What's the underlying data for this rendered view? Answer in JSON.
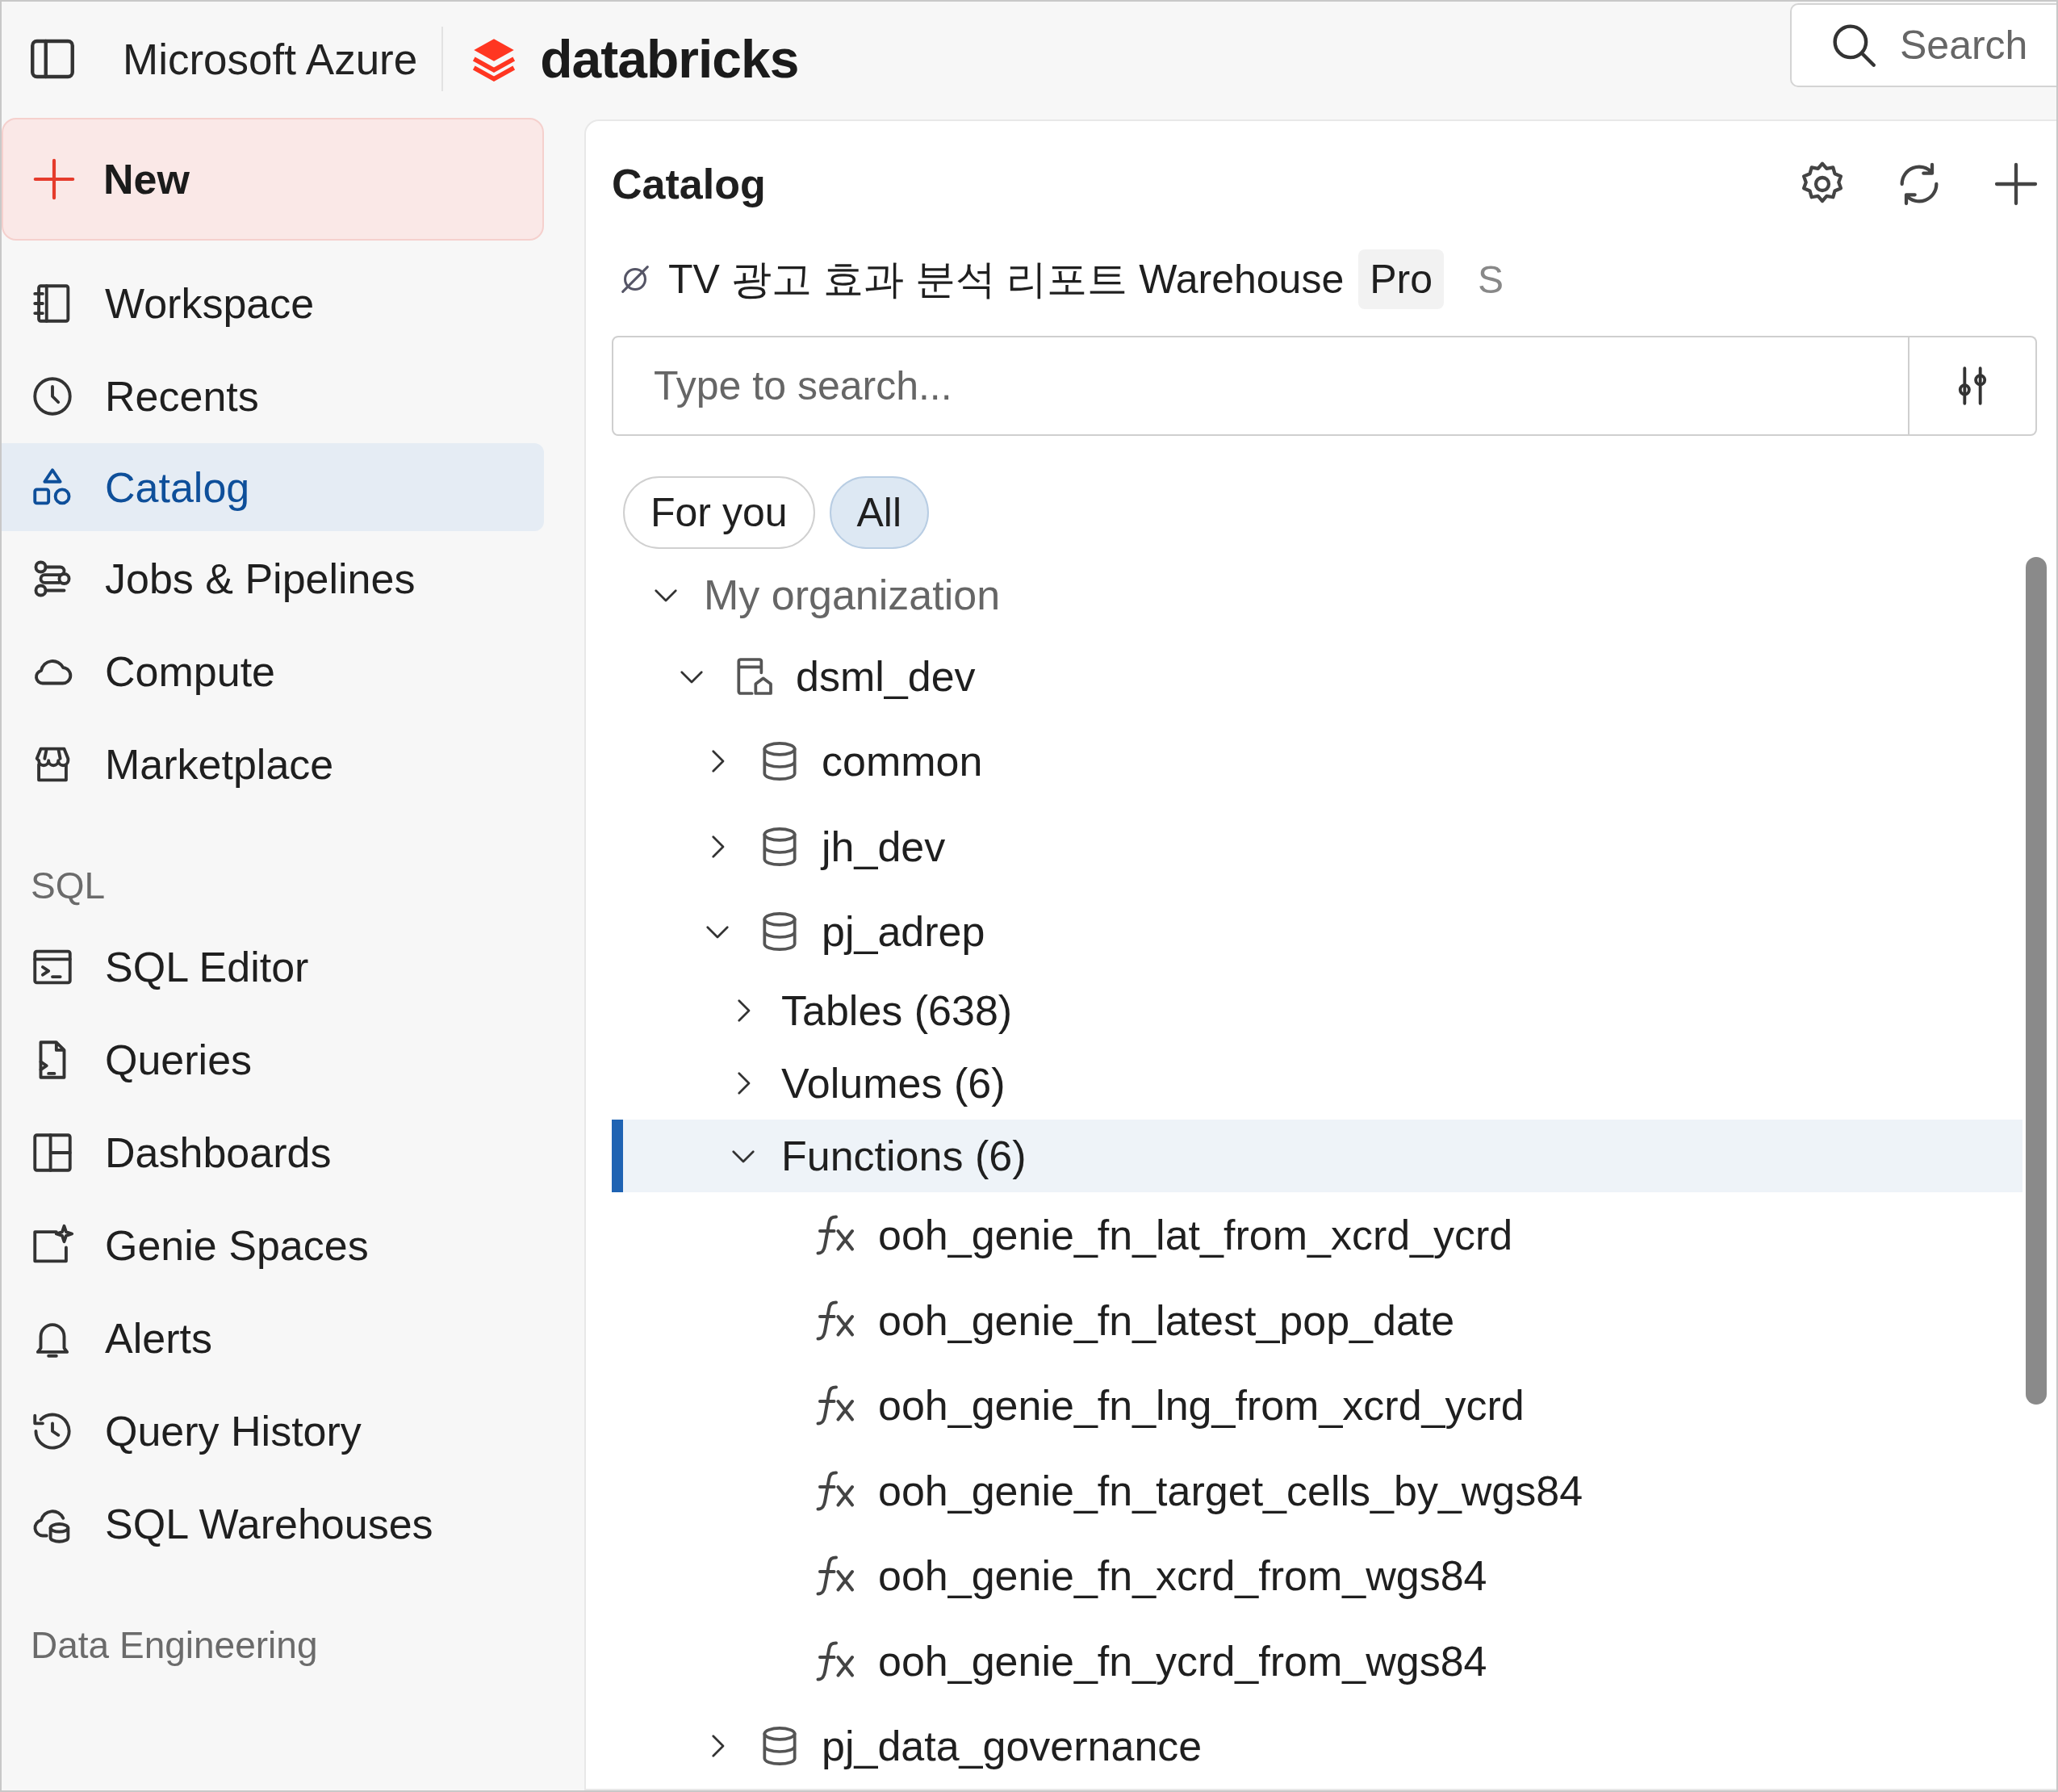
{
  "top_bar": {
    "menu_label": "Microsoft Azure",
    "brand": "databricks",
    "search": {
      "placeholder": "Search"
    }
  },
  "sidebar": {
    "new_button": "New",
    "sections": [
      {
        "items": [
          {
            "label": "Workspace",
            "selected": false
          },
          {
            "label": "Recents",
            "selected": false
          },
          {
            "label": "Catalog",
            "selected": true
          },
          {
            "label": "Jobs & Pipelines",
            "selected": false
          },
          {
            "label": "Compute",
            "selected": false
          },
          {
            "label": "Marketplace",
            "selected": false
          }
        ]
      },
      {
        "heading": "SQL",
        "items": [
          {
            "label": "SQL Editor",
            "selected": false
          },
          {
            "label": "Queries",
            "selected": false
          },
          {
            "label": "Dashboards",
            "selected": false
          },
          {
            "label": "Genie Spaces",
            "selected": false
          },
          {
            "label": "Alerts",
            "selected": false
          },
          {
            "label": "Query History",
            "selected": false
          },
          {
            "label": "SQL Warehouses",
            "selected": false
          }
        ]
      },
      {
        "heading": "Data Engineering"
      }
    ]
  },
  "catalog": {
    "title": "Catalog",
    "warehouse": {
      "name": "TV 광고 효과 분석 리포트 Warehouse",
      "badge": "Pro",
      "size": "S"
    },
    "search": {
      "placeholder": "Type to search..."
    },
    "filters": [
      {
        "label": "For you",
        "selected": false
      },
      {
        "label": "All",
        "selected": true
      }
    ],
    "tree": [
      {
        "label": "My organization",
        "kind": "group",
        "expanded": true,
        "selected": false,
        "children": [
          {
            "label": "dsml_dev",
            "kind": "catalog",
            "expanded": true,
            "selected": false,
            "children": [
              {
                "label": "common",
                "kind": "schema",
                "expanded": false,
                "selected": false
              },
              {
                "label": "jh_dev",
                "kind": "schema",
                "expanded": false,
                "selected": false
              },
              {
                "label": "pj_adrep",
                "kind": "schema",
                "expanded": true,
                "selected": false,
                "children": [
                  {
                    "label": "Tables (638)",
                    "kind": "category",
                    "expanded": false,
                    "selected": false
                  },
                  {
                    "label": "Volumes (6)",
                    "kind": "category",
                    "expanded": false,
                    "selected": false
                  },
                  {
                    "label": "Functions (6)",
                    "kind": "category",
                    "expanded": true,
                    "selected": true,
                    "children": [
                      {
                        "label": "ooh_genie_fn_lat_from_xcrd_ycrd",
                        "kind": "function",
                        "selected": false
                      },
                      {
                        "label": "ooh_genie_fn_latest_pop_date",
                        "kind": "function",
                        "selected": false
                      },
                      {
                        "label": "ooh_genie_fn_lng_from_xcrd_ycrd",
                        "kind": "function",
                        "selected": false
                      },
                      {
                        "label": "ooh_genie_fn_target_cells_by_wgs84",
                        "kind": "function",
                        "selected": false
                      },
                      {
                        "label": "ooh_genie_fn_xcrd_from_wgs84",
                        "kind": "function",
                        "selected": false
                      },
                      {
                        "label": "ooh_genie_fn_ycrd_from_wgs84",
                        "kind": "function",
                        "selected": false
                      }
                    ]
                  }
                ]
              },
              {
                "label": "pj_data_governance",
                "kind": "schema",
                "expanded": false,
                "selected": false
              }
            ]
          }
        ]
      }
    ]
  }
}
